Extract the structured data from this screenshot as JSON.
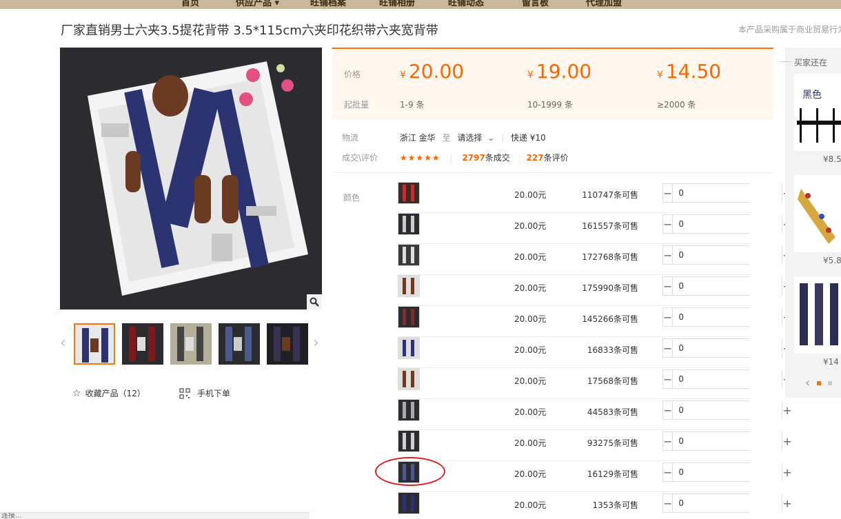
{
  "nav": {
    "items": [
      "首页",
      "供应产品 ▾",
      "旺铺档案",
      "旺铺相册",
      "旺铺动态",
      "留言板",
      "代理加盟"
    ]
  },
  "product": {
    "title": "厂家直销男士六夹3.5提花背带 3.5*115cm六夹印花织带六夹宽背带",
    "note": "本产品采购属于商业贸易行为"
  },
  "gallery": {
    "zoom_icon": "magnifier-icon",
    "thumb_count": 5
  },
  "actions": {
    "favorite_label": "收藏产品（12）",
    "mobile_label": "手机下单"
  },
  "price": {
    "price_label": "价格",
    "moq_label": "起批量",
    "currency": "¥",
    "tiers": [
      {
        "price": "20.00",
        "qty": "1-9 条"
      },
      {
        "price": "19.00",
        "qty": "10-1999 条"
      },
      {
        "price": "14.50",
        "qty": "≥2000 条"
      }
    ]
  },
  "logistics": {
    "label": "物流",
    "origin": "浙江 金华",
    "to": "至",
    "dest": "请选择",
    "express": "快递 ¥10"
  },
  "deals": {
    "label": "成交\\评价",
    "rating": 5,
    "deals_count": "2797",
    "deals_suffix": "条成交",
    "reviews_count": "227",
    "reviews_suffix": "条评价"
  },
  "sku": {
    "color_label": "颜色",
    "rows": [
      {
        "price": "20.00元",
        "stock": "110747条可售",
        "qty": "0"
      },
      {
        "price": "20.00元",
        "stock": "161557条可售",
        "qty": "0"
      },
      {
        "price": "20.00元",
        "stock": "172768条可售",
        "qty": "0"
      },
      {
        "price": "20.00元",
        "stock": "175990条可售",
        "qty": "0"
      },
      {
        "price": "20.00元",
        "stock": "145266条可售",
        "qty": "0"
      },
      {
        "price": "20.00元",
        "stock": "16833条可售",
        "qty": "0"
      },
      {
        "price": "20.00元",
        "stock": "17568条可售",
        "qty": "0"
      },
      {
        "price": "20.00元",
        "stock": "44583条可售",
        "qty": "0"
      },
      {
        "price": "20.00元",
        "stock": "93275条可售",
        "qty": "0"
      },
      {
        "price": "20.00元",
        "stock": "16129条可售",
        "qty": "0"
      },
      {
        "price": "20.00元",
        "stock": "1353条可售",
        "qty": "0"
      }
    ]
  },
  "sidebar": {
    "title": "买家还在",
    "cards": [
      {
        "label": "黑色",
        "price": "¥8.5"
      },
      {
        "label": "",
        "price": "¥5.8"
      },
      {
        "label": "",
        "price": "¥14"
      }
    ]
  },
  "status": {
    "text": "连接..."
  },
  "colors": {
    "accent": "#ff6600",
    "price_bg": "#fff6ee",
    "annotation": "#e02020"
  }
}
